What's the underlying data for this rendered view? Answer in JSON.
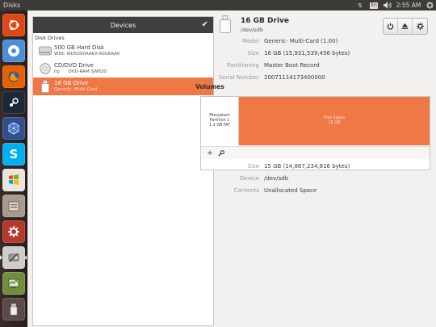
{
  "top_panel": {
    "app_title": "Disks",
    "keyboard_layout": "En",
    "time": "2:55 AM"
  },
  "launcher": {
    "items": [
      {
        "icon": "ubuntu-logo-icon",
        "color": "#dd4814"
      },
      {
        "icon": "chromium-icon",
        "color": "#4a90d9"
      },
      {
        "icon": "firefox-icon",
        "color": "#e66000"
      },
      {
        "icon": "steam-icon",
        "color": "#1b2838"
      },
      {
        "icon": "virtualbox-icon",
        "color": "#2f4f8f"
      },
      {
        "icon": "skype-icon",
        "color": "#00aff0"
      },
      {
        "icon": "windows-icon",
        "color": "#4caf50"
      },
      {
        "icon": "files-icon",
        "color": "#8d8d8d"
      },
      {
        "icon": "system-settings-icon",
        "color": "#c0392b"
      },
      {
        "icon": "disks-icon",
        "color": "#9a9a9a"
      },
      {
        "icon": "system-monitor-icon",
        "color": "#6f8f3a"
      },
      {
        "icon": "usb-drive-icon",
        "color": "#777777"
      }
    ]
  },
  "devices_pane": {
    "header": "Devices",
    "section": "Disk Drives",
    "drives": [
      {
        "name": "500 GB Hard Disk",
        "sub": "WDC WD5000AAKX-60U6AA0",
        "icon": "hard-disk-icon"
      },
      {
        "name": "CD/DVD Drive",
        "sub": "hp      DVD-RAM SW820",
        "icon": "optical-drive-icon"
      },
      {
        "name": "16 GB Drive",
        "sub": "Generic- Multi-Card",
        "icon": "flash-drive-icon",
        "selected": true
      }
    ]
  },
  "device": {
    "title": "16 GB Drive",
    "path": "/dev/sdb",
    "properties": [
      {
        "label": "Model",
        "value": "Generic- Multi-Card (1.00)"
      },
      {
        "label": "Size",
        "value": "16 GB (15,931,539,456 bytes)"
      },
      {
        "label": "Partitioning",
        "value": "Master Boot Record"
      },
      {
        "label": "Serial Number",
        "value": "20071114173400000"
      }
    ]
  },
  "volumes": {
    "label": "Volumes",
    "partition": {
      "line1": "Filesystem",
      "line2": "Partition 1",
      "line3": "1.1 GB FAT"
    },
    "free": {
      "line1": "Free Space",
      "line2": "15 GB"
    },
    "properties": [
      {
        "label": "Size",
        "value": "15 GB (14,867,234,816 bytes)"
      },
      {
        "label": "Device",
        "value": "/dev/sdb"
      },
      {
        "label": "Contents",
        "value": "Unallocated Space"
      }
    ]
  },
  "colors": {
    "accent": "#f07746",
    "panel": "#3c3b37",
    "pane_header": "#3f3f3f"
  }
}
